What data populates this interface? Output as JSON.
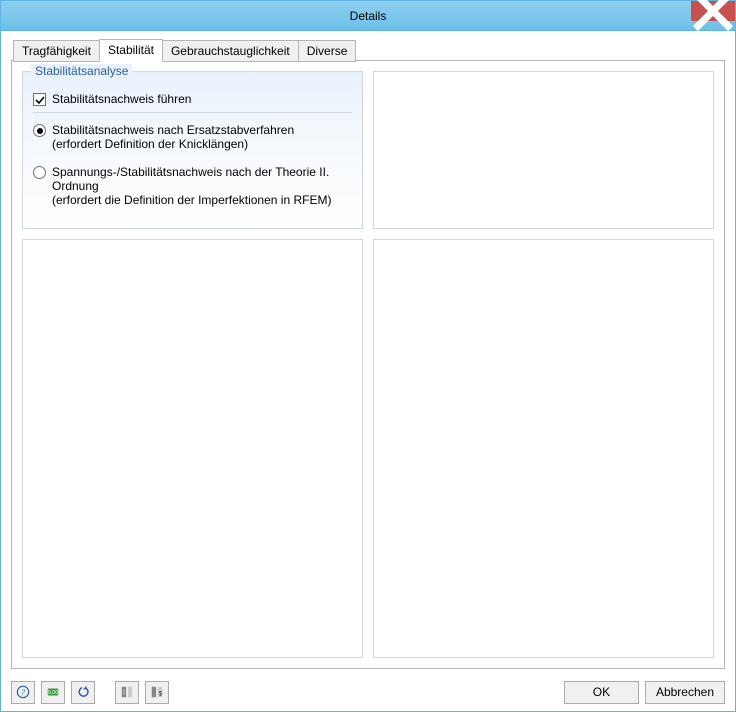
{
  "window": {
    "title": "Details"
  },
  "tabs": {
    "t0": "Tragfähigkeit",
    "t1": "Stabilität",
    "t2": "Gebrauchstauglichkeit",
    "t3": "Diverse"
  },
  "stability": {
    "legend": "Stabilitätsanalyse",
    "check_perform": "Stabilitätsnachweis führen",
    "radio1_line1": "Stabilitätsnachweis nach Ersatzstabverfahren",
    "radio1_line2": "(erfordert Definition der Knicklängen)",
    "radio2_line1": "Spannungs-/Stabilitätsnachweis nach der Theorie II. Ordnung",
    "radio2_line2": "(erfordert die Definition der Imperfektionen in RFEM)"
  },
  "buttons": {
    "ok": "OK",
    "cancel": "Abbrechen"
  },
  "colors": {
    "titlebar": "#6cbfe8",
    "border": "#5fb4e6",
    "close": "#c75050",
    "group_legend": "#2a5fa0"
  }
}
